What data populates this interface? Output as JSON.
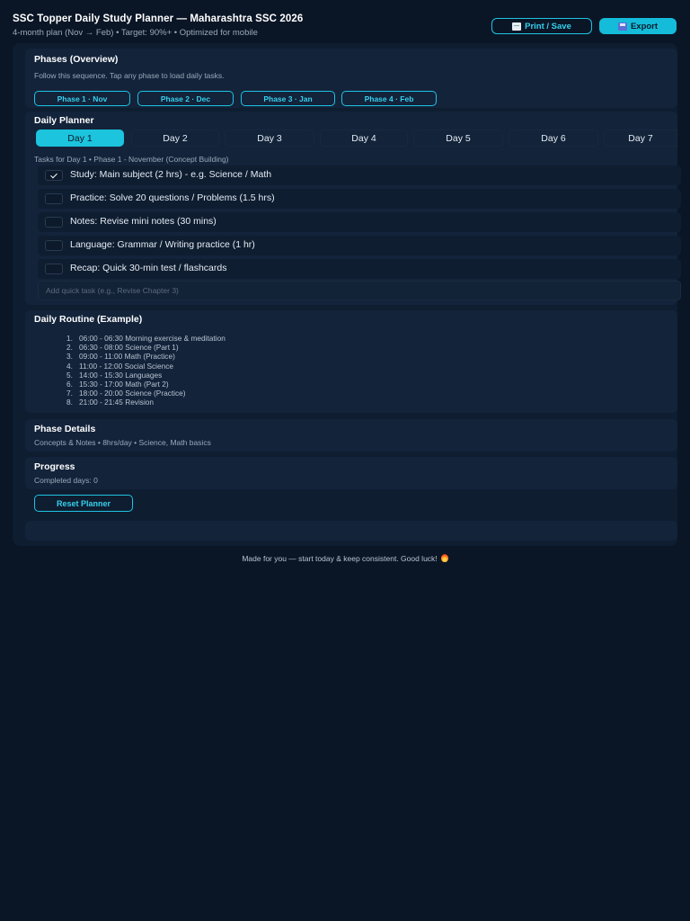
{
  "header": {
    "title": "SSC Topper Daily Study Planner — Maharashtra SSC 2026",
    "subtitle": "4-month plan (Nov → Feb) • Target: 90%+ • Optimized for mobile",
    "print_label": "Print / Save",
    "export_label": "Export",
    "print_icon": "document-icon",
    "export_icon": "floppy-disk-icon"
  },
  "phases": {
    "title": "Phases (Overview)",
    "hint": "Follow this sequence. Tap any phase to load daily tasks.",
    "buttons": [
      "Phase 1 · Nov",
      "Phase 2 · Dec",
      "Phase 3 · Jan",
      "Phase 4 · Feb"
    ]
  },
  "planner": {
    "title": "Daily Planner",
    "days": [
      "Day 1",
      "Day 2",
      "Day 3",
      "Day 4",
      "Day 5",
      "Day 6",
      "Day 7"
    ],
    "active_day": "Day 1",
    "tasks_header": "Tasks for Day 1 • Phase 1 - November (Concept Building)",
    "tasks": [
      {
        "label": "Study: Main subject (2 hrs) - e.g. Science / Math",
        "checked": true
      },
      {
        "label": "Practice: Solve 20 questions / Problems (1.5 hrs)",
        "checked": false
      },
      {
        "label": "Notes: Revise mini notes (30 mins)",
        "checked": false
      },
      {
        "label": "Language: Grammar / Writing practice (1 hr)",
        "checked": false
      },
      {
        "label": "Recap: Quick 30-min test / flashcards",
        "checked": false
      }
    ],
    "quick_task_placeholder": "Add quick task (e.g., Revise Chapter 3)"
  },
  "routine": {
    "title": "Daily Routine (Example)",
    "items": [
      "06:00 - 06:30 Morning exercise & meditation",
      "06:30 - 08:00 Science (Part 1)",
      "09:00 - 11:00 Math (Practice)",
      "11:00 - 12:00 Social Science",
      "14:00 - 15:30 Languages",
      "15:30 - 17:00 Math (Part 2)",
      "18:00 - 20:00 Science (Practice)",
      "21:00 - 21:45 Revision"
    ]
  },
  "phase_details": {
    "title": "Phase Details",
    "text": "Concepts & Notes • 8hrs/day • Science, Math basics"
  },
  "progress": {
    "title": "Progress",
    "completed": "Completed days: 0",
    "reset_label": "Reset Planner"
  },
  "footer": {
    "text": "Made for you — start today & keep consistent. Good luck!",
    "icon": "fire-icon"
  },
  "colors": {
    "background": "#0a1626",
    "panel": "#13233a",
    "accent": "#1cc4dd"
  }
}
